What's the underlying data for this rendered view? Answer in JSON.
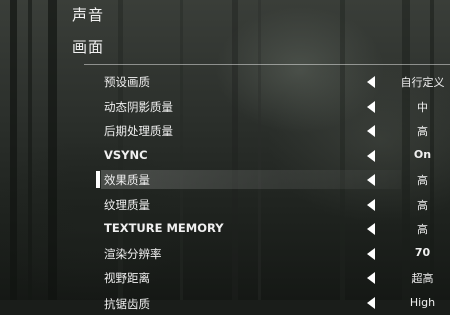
{
  "nav": {
    "sound": "声音",
    "graphics": "画面"
  },
  "settings": [
    {
      "label": "预设画质",
      "value": "自行定义"
    },
    {
      "label": "动态阴影质量",
      "value": "中"
    },
    {
      "label": "后期处理质量",
      "value": "高"
    },
    {
      "label": "VSYNC",
      "value": "On"
    },
    {
      "label": "效果质量",
      "value": "高"
    },
    {
      "label": "纹理质量",
      "value": "高"
    },
    {
      "label": "TEXTURE MEMORY",
      "value": "高"
    },
    {
      "label": "渲染分辨率",
      "value": "70"
    },
    {
      "label": "视野距离",
      "value": "超高"
    },
    {
      "label": "抗锯齿质",
      "value": "High"
    }
  ],
  "selected_index": 4,
  "icons": {
    "decrease": "arrow-left-icon"
  }
}
